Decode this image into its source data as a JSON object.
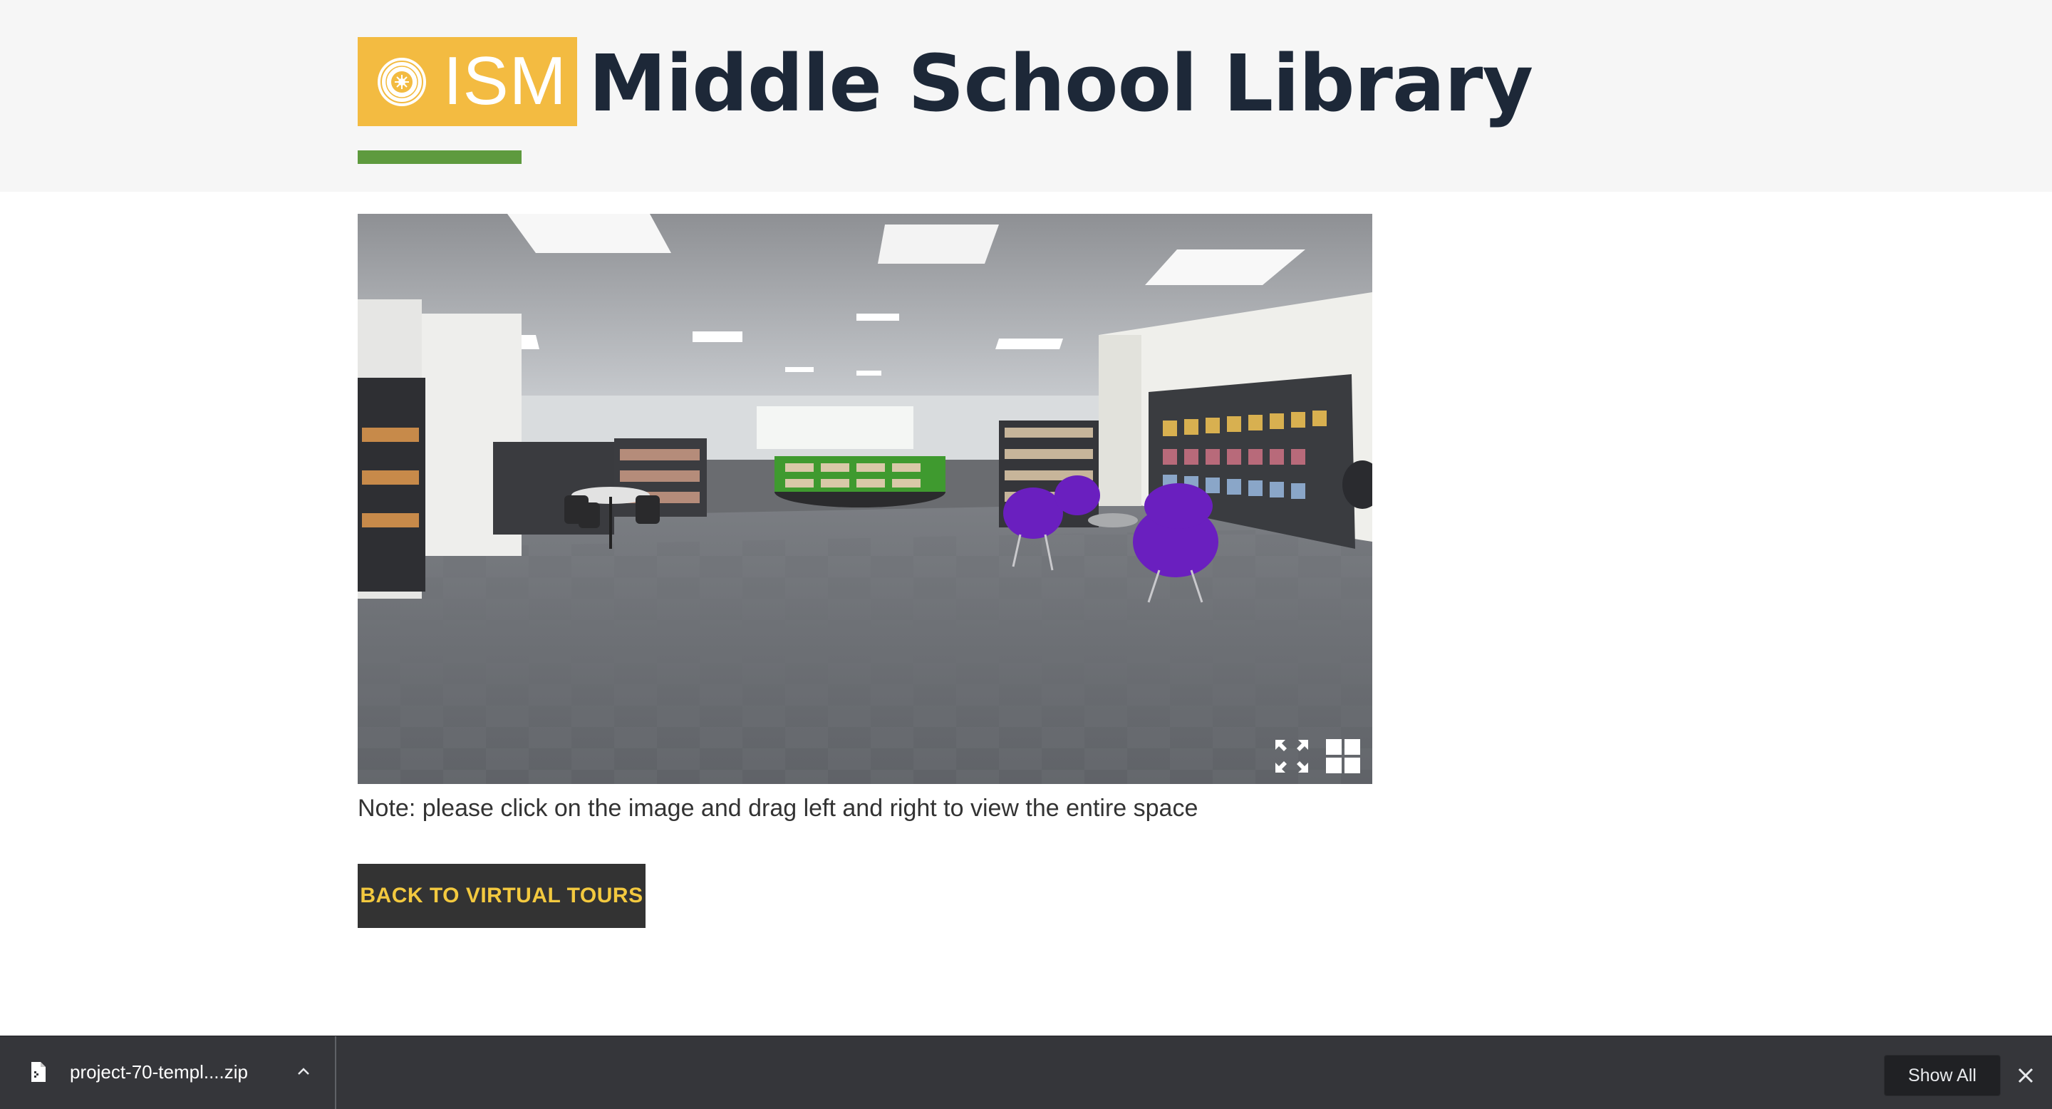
{
  "header": {
    "logo_text": "ISM",
    "title": "Middle School Library"
  },
  "viewer": {
    "fullscreen_icon": "fullscreen-expand-icon",
    "thumbnails_icon": "grid-thumbnails-icon"
  },
  "note": "Note: please click on the image and drag left and right to view the entire space",
  "back_button": "BACK TO VIRTUAL TOURS",
  "download_shelf": {
    "file_name": "project-70-templ....zip",
    "file_icon": "file-icon",
    "menu_icon": "chevron-up-icon",
    "show_all": "Show All",
    "close_icon": "close-icon"
  },
  "colors": {
    "logo_yellow": "#f3bb41",
    "title_navy": "#1d2838",
    "accent_green": "#5e9a3e",
    "button_bg": "#333333",
    "button_text": "#f3c93f",
    "shelf_bg": "#35363a"
  }
}
